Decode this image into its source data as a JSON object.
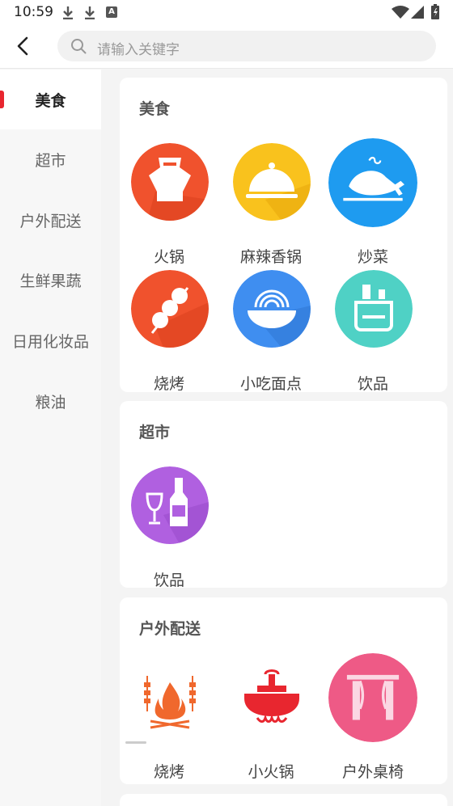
{
  "status_bar": {
    "time": "10:59",
    "badge": "A"
  },
  "search": {
    "placeholder": "请输入关键字"
  },
  "sidebar": {
    "items": [
      {
        "label": "美食",
        "active": true
      },
      {
        "label": "超市",
        "active": false
      },
      {
        "label": "户外配送",
        "active": false
      },
      {
        "label": "生鲜果蔬",
        "active": false
      },
      {
        "label": "日用化妆品",
        "active": false
      },
      {
        "label": "粮油",
        "active": false
      }
    ]
  },
  "sections": [
    {
      "title": "美食",
      "items": [
        {
          "label": "火锅",
          "icon": "hotpot-icon",
          "color": "#f0522d"
        },
        {
          "label": "麻辣香锅",
          "icon": "dish-cover-icon",
          "color": "#f9c21d"
        },
        {
          "label": "炒菜",
          "icon": "roast-meat-icon",
          "color": "#1e9bf0"
        },
        {
          "label": "烧烤",
          "icon": "skewer-icon",
          "color": "#f0522d"
        },
        {
          "label": "小吃面点",
          "icon": "noodle-bowl-icon",
          "color": "#3f8ef0"
        },
        {
          "label": "饮品",
          "icon": "drinks-icon",
          "color": "#4fd1c5"
        }
      ]
    },
    {
      "title": "超市",
      "items": [
        {
          "label": "饮品",
          "icon": "wine-icon",
          "color": "#b060e0"
        }
      ]
    },
    {
      "title": "户外配送",
      "items": [
        {
          "label": "烧烤",
          "icon": "campfire-bbq-icon",
          "color": "#f0682d"
        },
        {
          "label": "小火锅",
          "icon": "small-hotpot-icon",
          "color": "#e8262f"
        },
        {
          "label": "户外桌椅",
          "icon": "gate-icon",
          "color": "#ee5a86"
        }
      ]
    }
  ]
}
